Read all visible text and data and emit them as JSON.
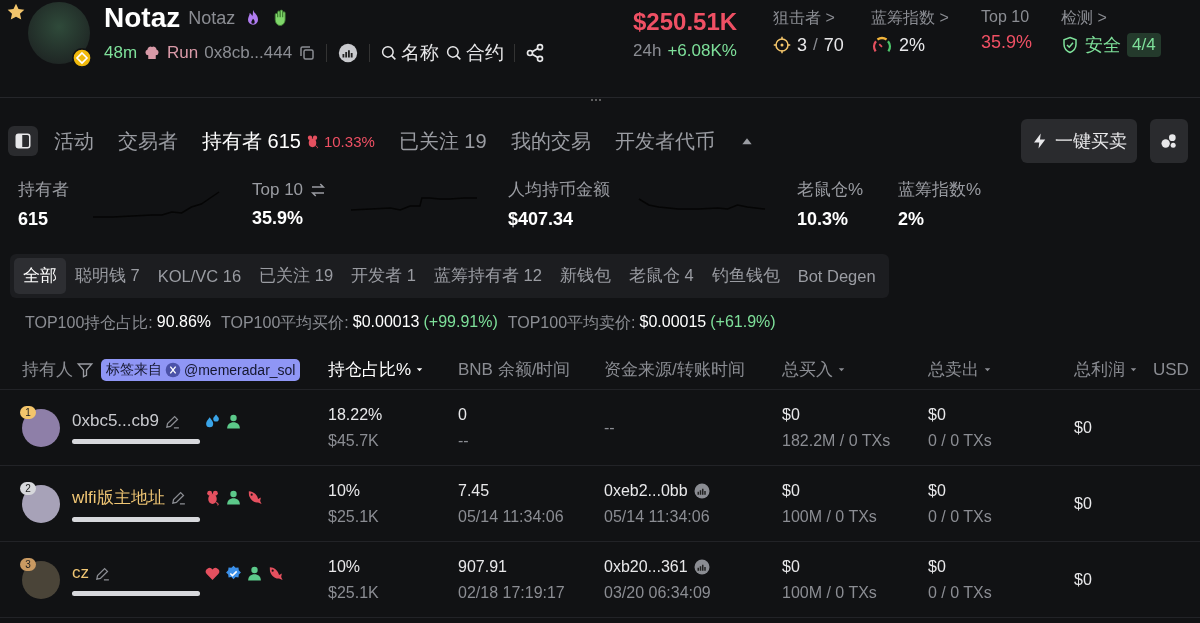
{
  "token": {
    "name": "Notaz",
    "symbol": "Notaz",
    "age": "48m",
    "platform": "Run",
    "address": "0x8cb...444",
    "search_links": [
      "名称",
      "合约"
    ]
  },
  "stats": {
    "price": "$250.51K",
    "period": "24h",
    "change": "+6.08K%",
    "snipers": {
      "label": "狙击者 >",
      "value": "3",
      "separator": "/",
      "total": "70"
    },
    "bluechip": {
      "label": "蓝筹指数 >",
      "value": "2%"
    },
    "top10": {
      "label": "Top 10",
      "value": "35.9%"
    },
    "audit": {
      "label": "检测 >",
      "status": "安全",
      "score": "4/4"
    }
  },
  "tabs": [
    {
      "label": "活动",
      "selected": false
    },
    {
      "label": "交易者",
      "selected": false
    },
    {
      "label": "持有者 615",
      "selected": true,
      "rat_share": "10.33%"
    },
    {
      "label": "已关注 19",
      "selected": false
    },
    {
      "label": "我的交易",
      "selected": false
    },
    {
      "label": "开发者代币",
      "selected": false
    }
  ],
  "actions": {
    "quick_trade": "一键买卖"
  },
  "metrics": [
    {
      "label": "持有者",
      "value": "615",
      "trend": true,
      "switchable": false
    },
    {
      "label": "Top 10",
      "value": "35.9%",
      "trend": true,
      "switchable": true
    },
    {
      "label": "人均持币金额",
      "value": "$407.34",
      "trend": true,
      "switchable": false
    },
    {
      "label": "老鼠仓%",
      "value": "10.3%",
      "trend": false,
      "switchable": false
    },
    {
      "label": "蓝筹指数%",
      "value": "2%",
      "trend": false,
      "switchable": false
    }
  ],
  "filters": [
    {
      "label": "全部",
      "selected": true
    },
    {
      "label": "聪明钱 7",
      "selected": false
    },
    {
      "label": "KOL/VC 16",
      "selected": false
    },
    {
      "label": "已关注 19",
      "selected": false
    },
    {
      "label": "开发者 1",
      "selected": false
    },
    {
      "label": "蓝筹持有者 12",
      "selected": false
    },
    {
      "label": "新钱包",
      "selected": false
    },
    {
      "label": "老鼠仓 4",
      "selected": false
    },
    {
      "label": "钓鱼钱包",
      "selected": false
    },
    {
      "label": "Bot Degen",
      "selected": false
    }
  ],
  "summary": [
    {
      "label": "TOP100持仓占比:",
      "value": "90.86%"
    },
    {
      "label": "TOP100平均买价:",
      "value": "$0.00013",
      "change": "(+99.91%)"
    },
    {
      "label": "TOP100平均卖价:",
      "value": "$0.00015",
      "change": "(+61.9%)"
    }
  ],
  "table": {
    "tag_source": {
      "label": "标签来自",
      "handle": "@memeradar_sol"
    },
    "columns": [
      {
        "label": "持有人",
        "kind": "filter"
      },
      {
        "label": "持仓占比%",
        "kind": "sort",
        "active": true
      },
      {
        "label": "BNB 余额/时间",
        "kind": "plain"
      },
      {
        "label": "资金来源/转账时间",
        "kind": "plain"
      },
      {
        "label": "总买入",
        "kind": "sort",
        "active": false
      },
      {
        "label": "总卖出",
        "kind": "sort",
        "active": false
      },
      {
        "label": "总利润",
        "kind": "sort",
        "active": false
      },
      {
        "label": "USD",
        "kind": "plain"
      }
    ],
    "rows": [
      {
        "rank": "1",
        "name": "0xbc5...cb9",
        "labeled": false,
        "tags": [
          {
            "kind": "drop"
          },
          {
            "kind": "user"
          }
        ],
        "level": 1,
        "share": "18.22%",
        "share_value": "$45.7K",
        "balance": "0",
        "balance_time": "--",
        "source": "--",
        "buy": "$0",
        "buy_detail": "182.2M / 0 TXs",
        "sell": "$0",
        "sell_detail": "0 / 0 TXs",
        "profit": "$0"
      },
      {
        "rank": "2",
        "name": "wlfi版主地址",
        "labeled": true,
        "tags": [
          {
            "kind": "rat"
          },
          {
            "kind": "user"
          },
          {
            "kind": "fish"
          }
        ],
        "level": 1,
        "share": "10%",
        "share_value": "$25.1K",
        "balance": "7.45",
        "balance_time": "05/14 11:34:06",
        "source": "0xeb2...0bb",
        "source_time": "05/14 11:34:06",
        "buy": "$0",
        "buy_detail": "100M / 0 TXs",
        "sell": "$0",
        "sell_detail": "0 / 0 TXs",
        "profit": "$0"
      },
      {
        "rank": "3",
        "name": "cz",
        "labeled": true,
        "tags": [
          {
            "kind": "heart"
          },
          {
            "kind": "verified"
          },
          {
            "kind": "user"
          },
          {
            "kind": "fish"
          }
        ],
        "level": 1,
        "share": "10%",
        "share_value": "$25.1K",
        "balance": "907.91",
        "balance_time": "02/18 17:19:17",
        "source": "0xb20...361",
        "source_time": "03/20 06:34:09",
        "buy": "$0",
        "buy_detail": "100M / 0 TXs",
        "sell": "$0",
        "sell_detail": "0 / 0 TXs",
        "profit": "$0"
      }
    ]
  }
}
